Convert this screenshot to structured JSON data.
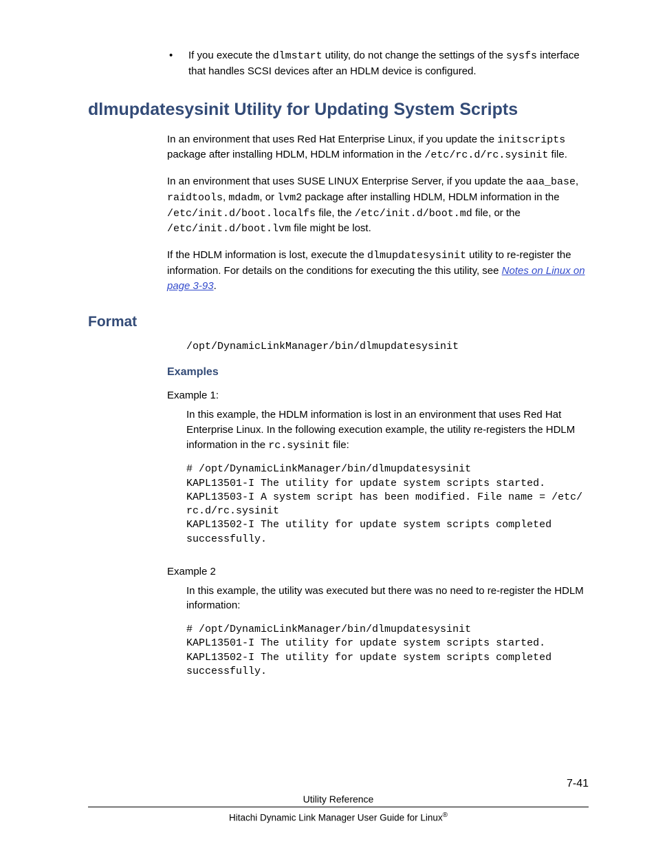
{
  "bullet": {
    "pre": "If you execute the ",
    "code1": "dlmstart",
    "mid": " utility, do not change the settings of the ",
    "code2": "sysfs",
    "post": " interface that handles SCSI devices after an HDLM device is configured."
  },
  "h1": "dlmupdatesysinit Utility for Updating System Scripts",
  "p1": {
    "a": "In an environment that uses Red Hat Enterprise Linux, if you update the ",
    "c1": "initscripts",
    "b": " package after installing HDLM, HDLM information in the ",
    "c2": "/etc/rc.d/rc.sysinit",
    "c": " file."
  },
  "p2": {
    "a": "In an environment that uses SUSE LINUX Enterprise Server, if you update the ",
    "c1": "aaa_base",
    "b": ", ",
    "c2": "raidtools",
    "c": ", ",
    "c3": "mdadm",
    "d": ", or ",
    "c4": "lvm2",
    "e": " package after installing HDLM, HDLM information in the ",
    "c5": "/etc/init.d/boot.localfs",
    "f": " file, the ",
    "c6": "/etc/init.d/boot.md",
    "g": " file, or the ",
    "c7": "/etc/init.d/boot.lvm",
    "h": " file might be lost."
  },
  "p3": {
    "a": "If the HDLM information is lost, execute the ",
    "c1": "dlmupdatesysinit",
    "b": " utility to re-register the information. For details on the conditions for executing the this utility, see ",
    "link": "Notes on Linux on page 3-93",
    "c": "."
  },
  "h2_format": "Format",
  "format_path": "/opt/DynamicLinkManager/bin/dlmupdatesysinit",
  "h3_examples": "Examples",
  "ex1": {
    "label": "Example 1:",
    "desc_a": "In this example, the HDLM information is lost in an environment that uses Red Hat Enterprise Linux. In the following execution example, the utility re-registers the HDLM information in the ",
    "desc_code": "rc.sysinit",
    "desc_b": " file:",
    "code": "# /opt/DynamicLinkManager/bin/dlmupdatesysinit\nKAPL13501-I The utility for update system scripts started.\nKAPL13503-I A system script has been modified. File name = /etc/\nrc.d/rc.sysinit\nKAPL13502-I The utility for update system scripts completed \nsuccessfully."
  },
  "ex2": {
    "label": "Example 2",
    "desc": "In this example, the utility was executed but there was no need to re-register the HDLM information:",
    "code": "# /opt/DynamicLinkManager/bin/dlmupdatesysinit\nKAPL13501-I The utility for update system scripts started.\nKAPL13502-I The utility for update system scripts completed \nsuccessfully."
  },
  "footer": {
    "center1": "Utility Reference",
    "pagenum": "7-41",
    "center2_a": "Hitachi Dynamic Link Manager User Guide for Linux",
    "reg": "®"
  }
}
